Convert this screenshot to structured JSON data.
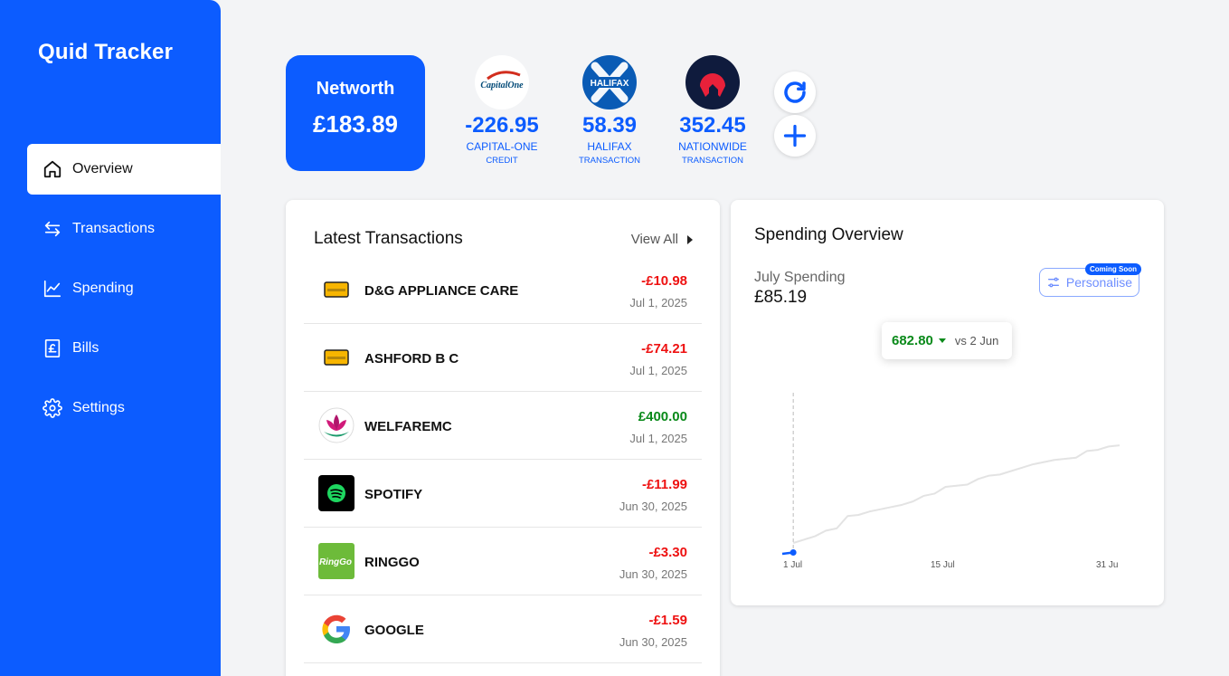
{
  "app": {
    "title": "Quid Tracker"
  },
  "sidebar": {
    "items": [
      {
        "label": "Overview",
        "icon": "home-icon",
        "active": true
      },
      {
        "label": "Transactions",
        "icon": "arrows-icon",
        "active": false
      },
      {
        "label": "Spending",
        "icon": "chart-line-icon",
        "active": false
      },
      {
        "label": "Bills",
        "icon": "pound-receipt-icon",
        "active": false
      },
      {
        "label": "Settings",
        "icon": "gear-icon",
        "active": false
      }
    ]
  },
  "networth": {
    "label": "Networth",
    "value": "£183.89"
  },
  "accounts": [
    {
      "balance": "-226.95",
      "name": "CAPITAL-ONE",
      "type": "CREDIT",
      "logo": "capital-one-logo",
      "logo_text": "CapitalOne"
    },
    {
      "balance": "58.39",
      "name": "HALIFAX",
      "type": "TRANSACTION",
      "logo": "halifax-logo",
      "logo_text": "HALIFAX"
    },
    {
      "balance": "352.45",
      "name": "NATIONWIDE",
      "type": "TRANSACTION",
      "logo": "nationwide-logo"
    }
  ],
  "actions": {
    "refresh_icon": "refresh-icon",
    "add_icon": "plus-icon"
  },
  "latest_transactions": {
    "title": "Latest Transactions",
    "view_all": "View All",
    "items": [
      {
        "name": "D&G APPLIANCE CARE",
        "amount": "-£10.98",
        "date": "Jul 1, 2025",
        "sign": "neg",
        "icon": "card-icon"
      },
      {
        "name": "ASHFORD B C",
        "amount": "-£74.21",
        "date": "Jul 1, 2025",
        "sign": "neg",
        "icon": "card-icon"
      },
      {
        "name": "WELFAREMC",
        "amount": "£400.00",
        "date": "Jul 1, 2025",
        "sign": "pos",
        "icon": "lotus-logo"
      },
      {
        "name": "SPOTIFY",
        "amount": "-£11.99",
        "date": "Jun 30, 2025",
        "sign": "neg",
        "icon": "spotify-logo"
      },
      {
        "name": "RINGGO",
        "amount": "-£3.30",
        "date": "Jun 30, 2025",
        "sign": "neg",
        "icon": "ringgo-logo",
        "logo_text": "RingGo"
      },
      {
        "name": "GOOGLE",
        "amount": "-£1.59",
        "date": "Jun 30, 2025",
        "sign": "neg",
        "icon": "google-logo"
      }
    ]
  },
  "spending": {
    "title": "Spending Overview",
    "period_label": "July Spending",
    "period_value": "£85.19",
    "personalise": "Personalise",
    "coming_soon": "Coming Soon",
    "tooltip_value": "682.80",
    "tooltip_compare": "vs 2 Jun"
  },
  "chart_data": {
    "type": "line",
    "x_ticks": [
      "1 Jul",
      "15 Jul",
      "31 Ju"
    ],
    "series": [
      {
        "days": [
          0,
          1
        ],
        "values": [
          0,
          85.19
        ],
        "color": "#0c5cff"
      },
      {
        "days": [
          1,
          2,
          3,
          4,
          5,
          6,
          7,
          8,
          9,
          10,
          11,
          12,
          13,
          14,
          15,
          16,
          17,
          18,
          19,
          20,
          21,
          22,
          23,
          24,
          25,
          26,
          27,
          28,
          29,
          30,
          31
        ],
        "values": [
          0,
          30,
          60,
          110,
          130,
          240,
          250,
          280,
          300,
          320,
          340,
          370,
          420,
          440,
          500,
          510,
          520,
          570,
          600,
          610,
          640,
          670,
          700,
          720,
          740,
          750,
          760,
          820,
          830,
          860,
          870
        ],
        "color": "#e3e3e3"
      }
    ],
    "ylim": [
      0,
      900
    ],
    "xlim": [
      1,
      31
    ],
    "marker_day": 2
  }
}
